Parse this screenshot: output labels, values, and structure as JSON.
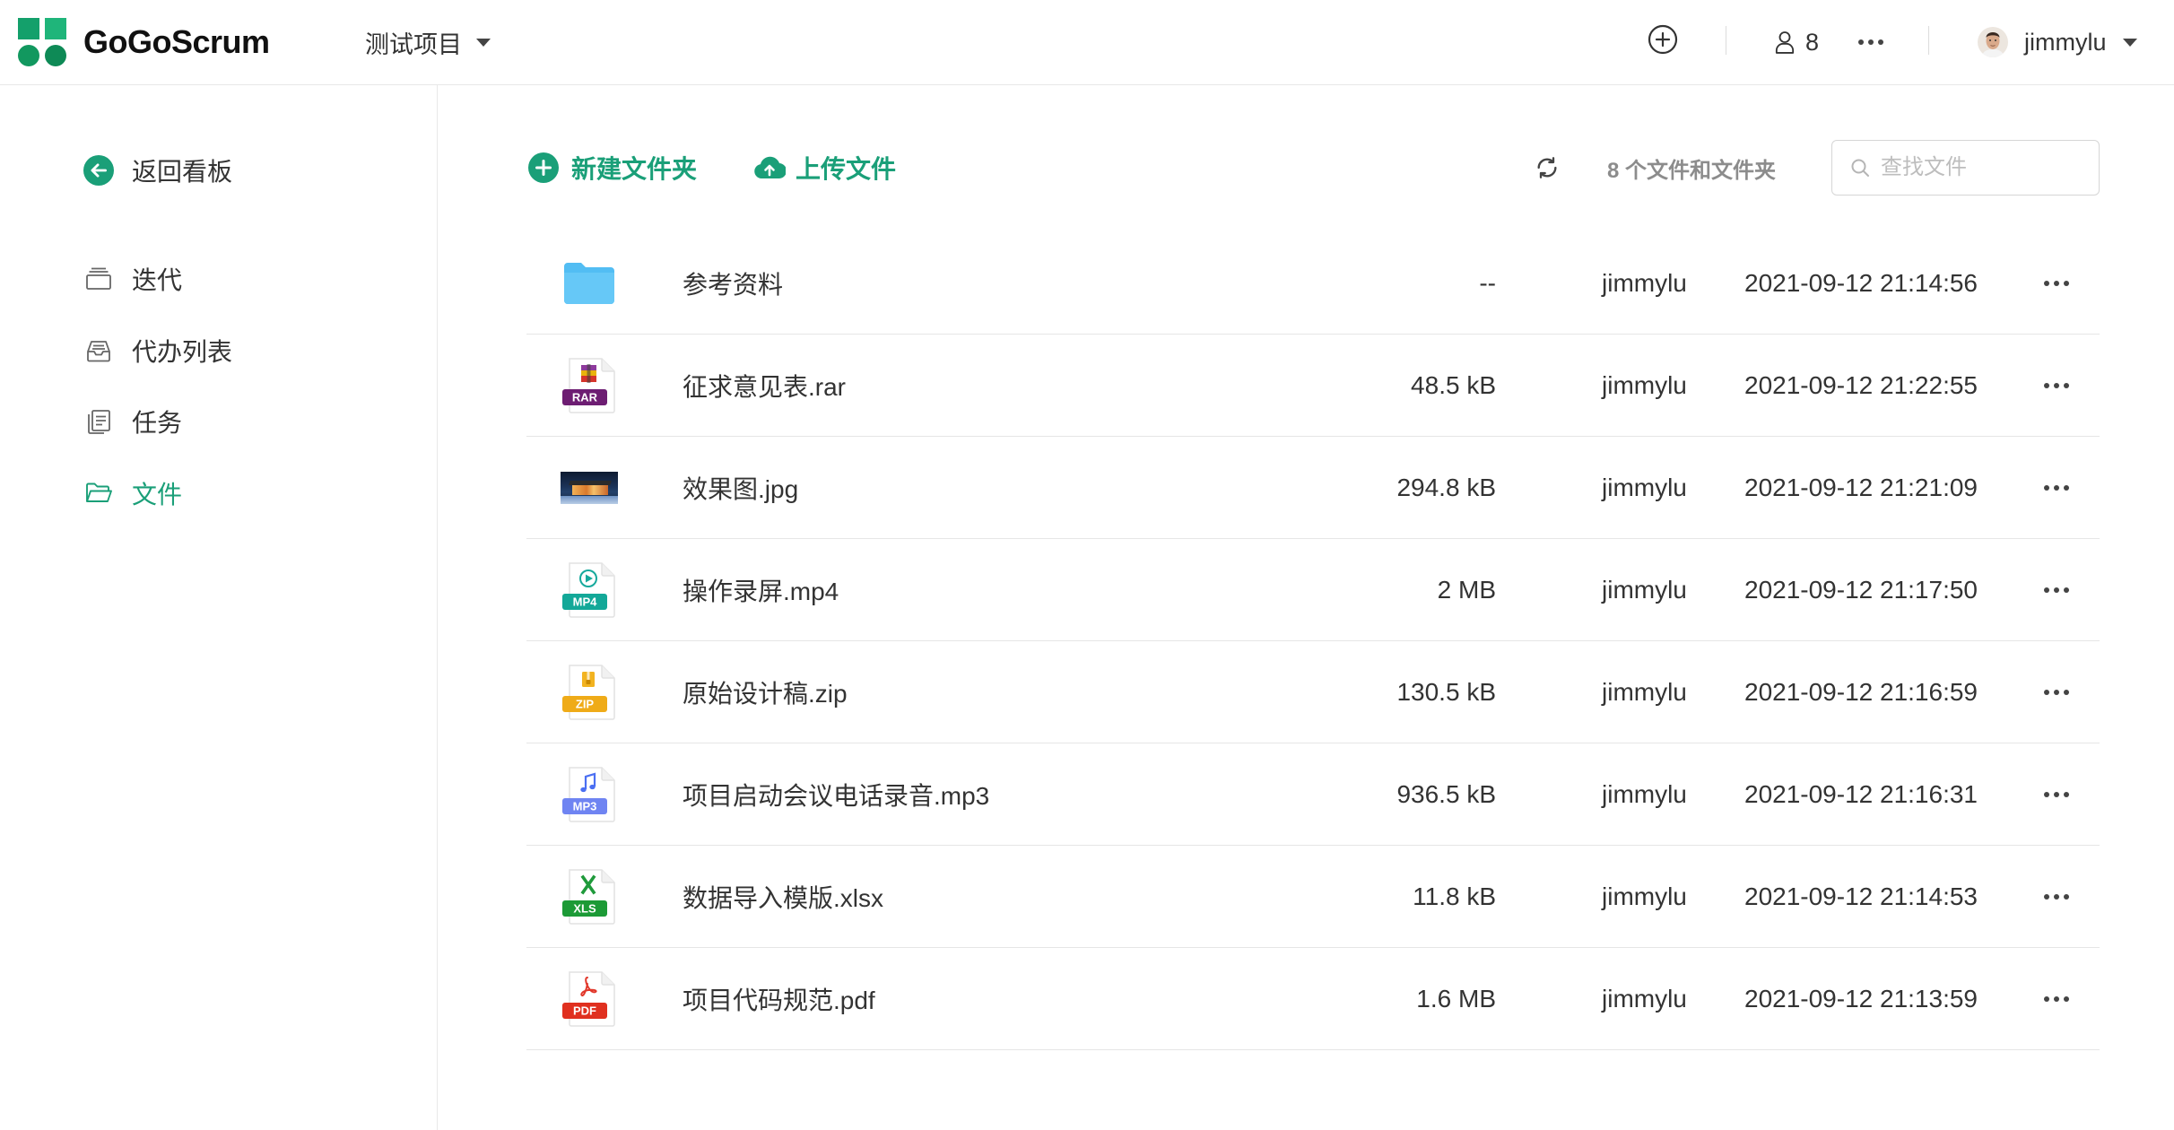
{
  "app": {
    "name": "GoGoScrum"
  },
  "colors": {
    "accent": "#1a9f78",
    "text": "#333333",
    "muted": "#8c8c8c",
    "divider": "#e6e6e6"
  },
  "header": {
    "project": "测试项目",
    "member_count": "8",
    "user": "jimmylu",
    "icons": [
      "plus-circle-icon",
      "user-icon",
      "ellipsis-icon",
      "avatar",
      "caret-down-icon"
    ]
  },
  "sidebar": {
    "back": {
      "label": "返回看板",
      "icon": "arrow-left-circle-icon"
    },
    "items": [
      {
        "label": "迭代",
        "icon": "iteration-icon",
        "active": false
      },
      {
        "label": "代办列表",
        "icon": "inbox-icon",
        "active": false
      },
      {
        "label": "任务",
        "icon": "task-icon",
        "active": false
      },
      {
        "label": "文件",
        "icon": "folder-open-icon",
        "active": true
      }
    ]
  },
  "toolbar": {
    "new_folder": "新建文件夹",
    "upload": "上传文件",
    "count_text": "8 个文件和文件夹",
    "search_placeholder": "查找文件"
  },
  "files": [
    {
      "name": "参考资料",
      "icon": "folder-icon",
      "size": "--",
      "owner": "jimmylu",
      "modified": "2021-09-12 21:14:56"
    },
    {
      "name": "征求意见表.rar",
      "icon": "rar-file-icon",
      "badge": "RAR",
      "size": "48.5 kB",
      "owner": "jimmylu",
      "modified": "2021-09-12 21:22:55"
    },
    {
      "name": "效果图.jpg",
      "icon": "image-thumbnail",
      "size": "294.8 kB",
      "owner": "jimmylu",
      "modified": "2021-09-12 21:21:09"
    },
    {
      "name": "操作录屏.mp4",
      "icon": "mp4-file-icon",
      "badge": "MP4",
      "size": "2 MB",
      "owner": "jimmylu",
      "modified": "2021-09-12 21:17:50"
    },
    {
      "name": "原始设计稿.zip",
      "icon": "zip-file-icon",
      "badge": "ZIP",
      "size": "130.5 kB",
      "owner": "jimmylu",
      "modified": "2021-09-12 21:16:59"
    },
    {
      "name": "项目启动会议电话录音.mp3",
      "icon": "mp3-file-icon",
      "badge": "MP3",
      "size": "936.5 kB",
      "owner": "jimmylu",
      "modified": "2021-09-12 21:16:31"
    },
    {
      "name": "数据导入模版.xlsx",
      "icon": "xls-file-icon",
      "badge": "XLS",
      "size": "11.8 kB",
      "owner": "jimmylu",
      "modified": "2021-09-12 21:14:53"
    },
    {
      "name": "项目代码规范.pdf",
      "icon": "pdf-file-icon",
      "badge": "PDF",
      "size": "1.6 MB",
      "owner": "jimmylu",
      "modified": "2021-09-12 21:13:59"
    }
  ]
}
